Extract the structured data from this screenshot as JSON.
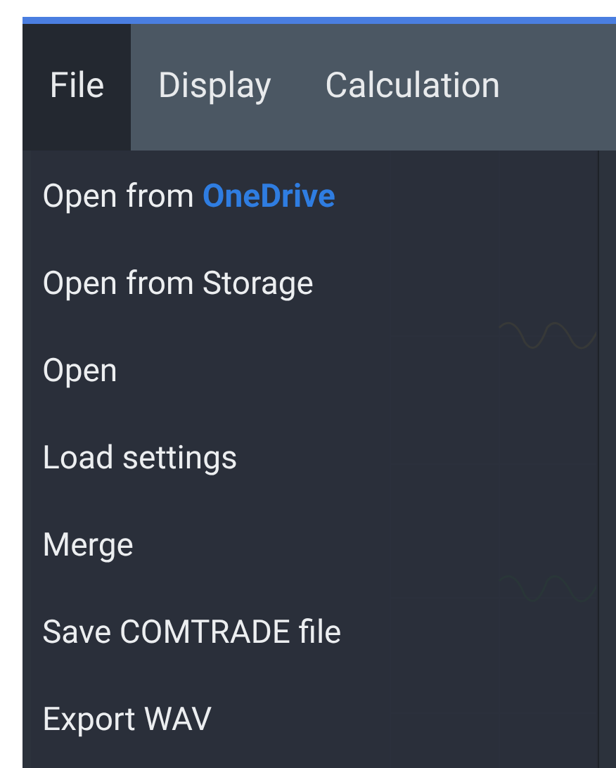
{
  "menubar": {
    "items": [
      {
        "label": "File",
        "selected": true
      },
      {
        "label": "Display",
        "selected": false
      },
      {
        "label": "Calculation",
        "selected": false
      }
    ]
  },
  "file_menu": {
    "items": [
      {
        "label": "Open from **OneDrive**"
      },
      {
        "label": "Open from Storage"
      },
      {
        "label": "Open"
      },
      {
        "label": "Load settings"
      },
      {
        "label": "Merge"
      },
      {
        "label": "Save COMTRADE file"
      },
      {
        "label": "Export WAV"
      }
    ]
  }
}
